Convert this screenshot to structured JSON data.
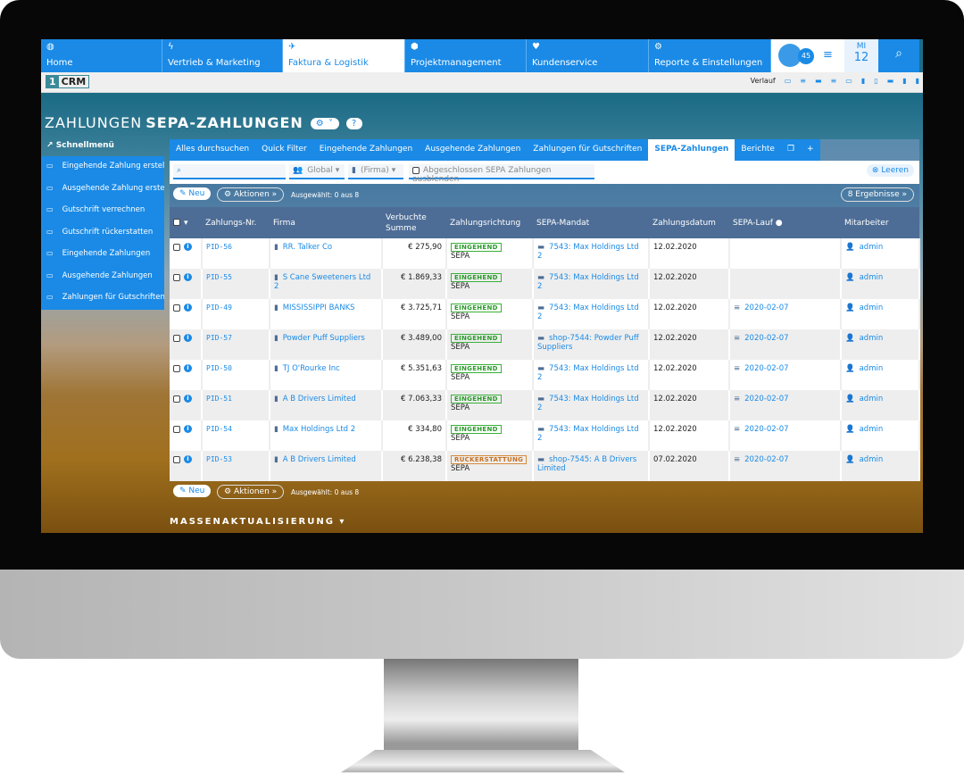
{
  "nav": {
    "tabs": [
      {
        "label": "Home",
        "icon": "globe-icon",
        "glyph": "◍"
      },
      {
        "label": "Vertrieb & Marketing",
        "icon": "bolt-icon",
        "glyph": "ϟ"
      },
      {
        "label": "Faktura & Logistik",
        "icon": "paper-plane-icon",
        "glyph": "✈"
      },
      {
        "label": "Projektmanagement",
        "icon": "cube-icon",
        "glyph": "⬢"
      },
      {
        "label": "Kundenservice",
        "icon": "heart-icon",
        "glyph": "♥"
      },
      {
        "label": "Reporte & Einstellungen",
        "icon": "gear-icon",
        "glyph": "⚙"
      }
    ],
    "active": "Faktura & Logistik",
    "notifications": "45",
    "day": "MI",
    "date": "12"
  },
  "logo": {
    "one": "1",
    "crm": "CRM"
  },
  "history": {
    "label": "Verlauf"
  },
  "title": {
    "module": "ZAHLUNGEN",
    "sub": "SEPA-ZAHLUNGEN"
  },
  "sidebar": {
    "header": "Schnellmenü",
    "items": [
      "Eingehende Zahlung erstellen",
      "Ausgehende Zahlung erstellen",
      "Gutschrift verrechnen",
      "Gutschrift rückerstatten",
      "Eingehende Zahlungen",
      "Ausgehende Zahlungen",
      "Zahlungen für Gutschriften"
    ]
  },
  "tabs": [
    "Alles durchsuchen",
    "Quick Filter",
    "Eingehende Zahlungen",
    "Ausgehende Zahlungen",
    "Zahlungen für Gutschriften",
    "SEPA-Zahlungen",
    "Berichte"
  ],
  "filter": {
    "search_placeholder": "",
    "scope": "Global",
    "firma": "(Firma)",
    "hide_completed": "Abgeschlossen SEPA Zahlungen ausblenden",
    "clear": "Leeren"
  },
  "actions": {
    "new": "Neu",
    "actions": "Aktionen",
    "selected": "Ausgewählt: 0 aus 8",
    "results": "8 Ergebnisse"
  },
  "columns": [
    "Zahlungs-Nr.",
    "Firma",
    "Verbuchte Summe",
    "Zahlungsrichtung",
    "SEPA-Mandat",
    "Zahlungsdatum",
    "SEPA-Lauf",
    "Mitarbeiter"
  ],
  "rows": [
    {
      "nr": "PID-56",
      "firma": "RR. Talker Co",
      "summe": "€ 275,90",
      "richtung": "EINGEHEND",
      "typ": "SEPA",
      "mandat": "7543: Max Holdings Ltd 2",
      "datum": "12.02.2020",
      "lauf": "",
      "mitarbeiter": "admin"
    },
    {
      "nr": "PID-55",
      "firma": "S Cane Sweeteners Ltd 2",
      "summe": "€ 1.869,33",
      "richtung": "EINGEHEND",
      "typ": "SEPA",
      "mandat": "7543: Max Holdings Ltd 2",
      "datum": "12.02.2020",
      "lauf": "",
      "mitarbeiter": "admin"
    },
    {
      "nr": "PID-49",
      "firma": "MISSISSIPPI BANKS",
      "summe": "€ 3.725,71",
      "richtung": "EINGEHEND",
      "typ": "SEPA",
      "mandat": "7543: Max Holdings Ltd 2",
      "datum": "12.02.2020",
      "lauf": "2020-02-07",
      "mitarbeiter": "admin"
    },
    {
      "nr": "PID-57",
      "firma": "Powder Puff Suppliers",
      "summe": "€ 3.489,00",
      "richtung": "EINGEHEND",
      "typ": "SEPA",
      "mandat": "shop-7544: Powder Puff Suppliers",
      "datum": "12.02.2020",
      "lauf": "2020-02-07",
      "mitarbeiter": "admin"
    },
    {
      "nr": "PID-50",
      "firma": "TJ O'Rourke Inc",
      "summe": "€ 5.351,63",
      "richtung": "EINGEHEND",
      "typ": "SEPA",
      "mandat": "7543: Max Holdings Ltd 2",
      "datum": "12.02.2020",
      "lauf": "2020-02-07",
      "mitarbeiter": "admin"
    },
    {
      "nr": "PID-51",
      "firma": "A B Drivers Limited",
      "summe": "€ 7.063,33",
      "richtung": "EINGEHEND",
      "typ": "SEPA",
      "mandat": "7543: Max Holdings Ltd 2",
      "datum": "12.02.2020",
      "lauf": "2020-02-07",
      "mitarbeiter": "admin"
    },
    {
      "nr": "PID-54",
      "firma": "Max Holdings Ltd 2",
      "summe": "€ 334,80",
      "richtung": "EINGEHEND",
      "typ": "SEPA",
      "mandat": "7543: Max Holdings Ltd 2",
      "datum": "12.02.2020",
      "lauf": "2020-02-07",
      "mitarbeiter": "admin"
    },
    {
      "nr": "PID-53",
      "firma": "A B Drivers Limited",
      "summe": "€ 6.238,38",
      "richtung": "RÜCKERSTATTUNG",
      "typ": "SEPA",
      "mandat": "shop-7545: A B Drivers Limited",
      "datum": "07.02.2020",
      "lauf": "2020-02-07",
      "mitarbeiter": "admin"
    }
  ],
  "mass_update": "MASSENAKTUALISIERUNG",
  "colors": {
    "accent": "#1a8ae6",
    "header": "#4d6d96",
    "incoming": "#2a9a2a",
    "refund": "#c87020"
  }
}
